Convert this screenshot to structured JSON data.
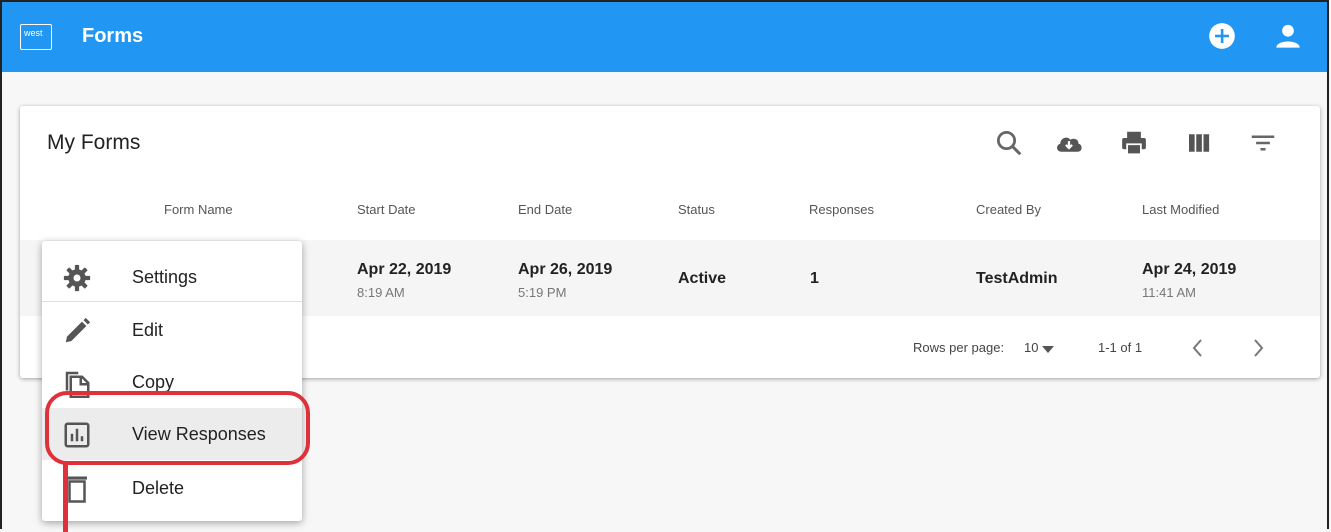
{
  "app": {
    "logo_text": "west",
    "title": "Forms",
    "add_icon": "add-circle-icon",
    "account_icon": "account-icon",
    "accent_color": "#2196f3"
  },
  "card": {
    "title": "My Forms",
    "toolbar_icons": [
      "search-icon",
      "cloud-download-icon",
      "print-icon",
      "view-columns-icon",
      "filter-icon"
    ]
  },
  "table": {
    "columns": [
      "Form Name",
      "Start Date",
      "End Date",
      "Status",
      "Responses",
      "Created By",
      "Last Modified"
    ],
    "rows": [
      {
        "start_date": "Apr 22, 2019",
        "start_time": "8:19 AM",
        "end_date": "Apr 26, 2019",
        "end_time": "5:19 PM",
        "status": "Active",
        "responses": "1",
        "created_by": "TestAdmin",
        "modified_date": "Apr 24, 2019",
        "modified_time": "11:41 AM"
      }
    ]
  },
  "pagination": {
    "rows_per_page_label": "Rows per page:",
    "rows_per_page_value": "10",
    "range": "1-1 of 1"
  },
  "menu": {
    "items": [
      {
        "label": "Settings",
        "icon": "gear-icon"
      },
      {
        "label": "Edit",
        "icon": "pencil-icon"
      },
      {
        "label": "Copy",
        "icon": "copy-icon"
      },
      {
        "label": "View Responses",
        "icon": "bar-chart-icon"
      },
      {
        "label": "Delete",
        "icon": "trash-icon"
      }
    ],
    "highlight_color": "#e0303a"
  }
}
